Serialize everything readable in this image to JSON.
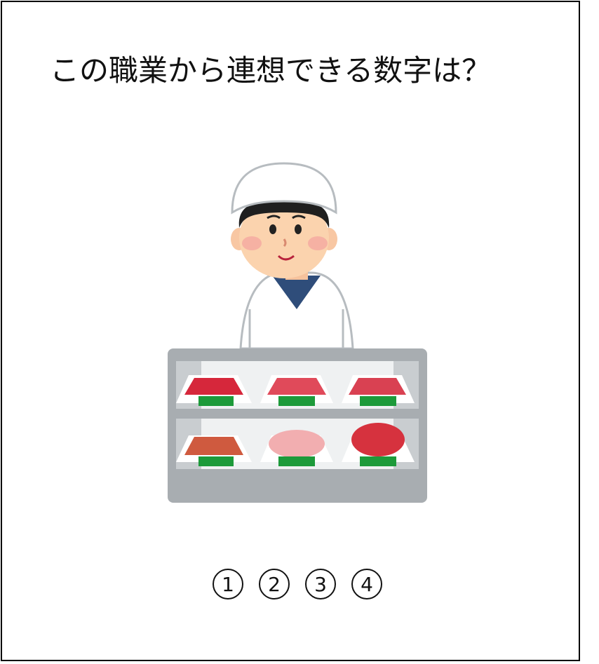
{
  "question": {
    "text": "この職業から連想できる数字は？"
  },
  "illustration": {
    "subject_icon": "butcher-at-meat-counter",
    "colors": {
      "meat_red": "#d6273b",
      "tray_label": "#1d9a3a",
      "counter": "#a8adb1",
      "uniform": "#ffffff",
      "skin": "#fbd3ae"
    }
  },
  "choices": [
    {
      "label": "1"
    },
    {
      "label": "2"
    },
    {
      "label": "3"
    },
    {
      "label": "4"
    }
  ]
}
